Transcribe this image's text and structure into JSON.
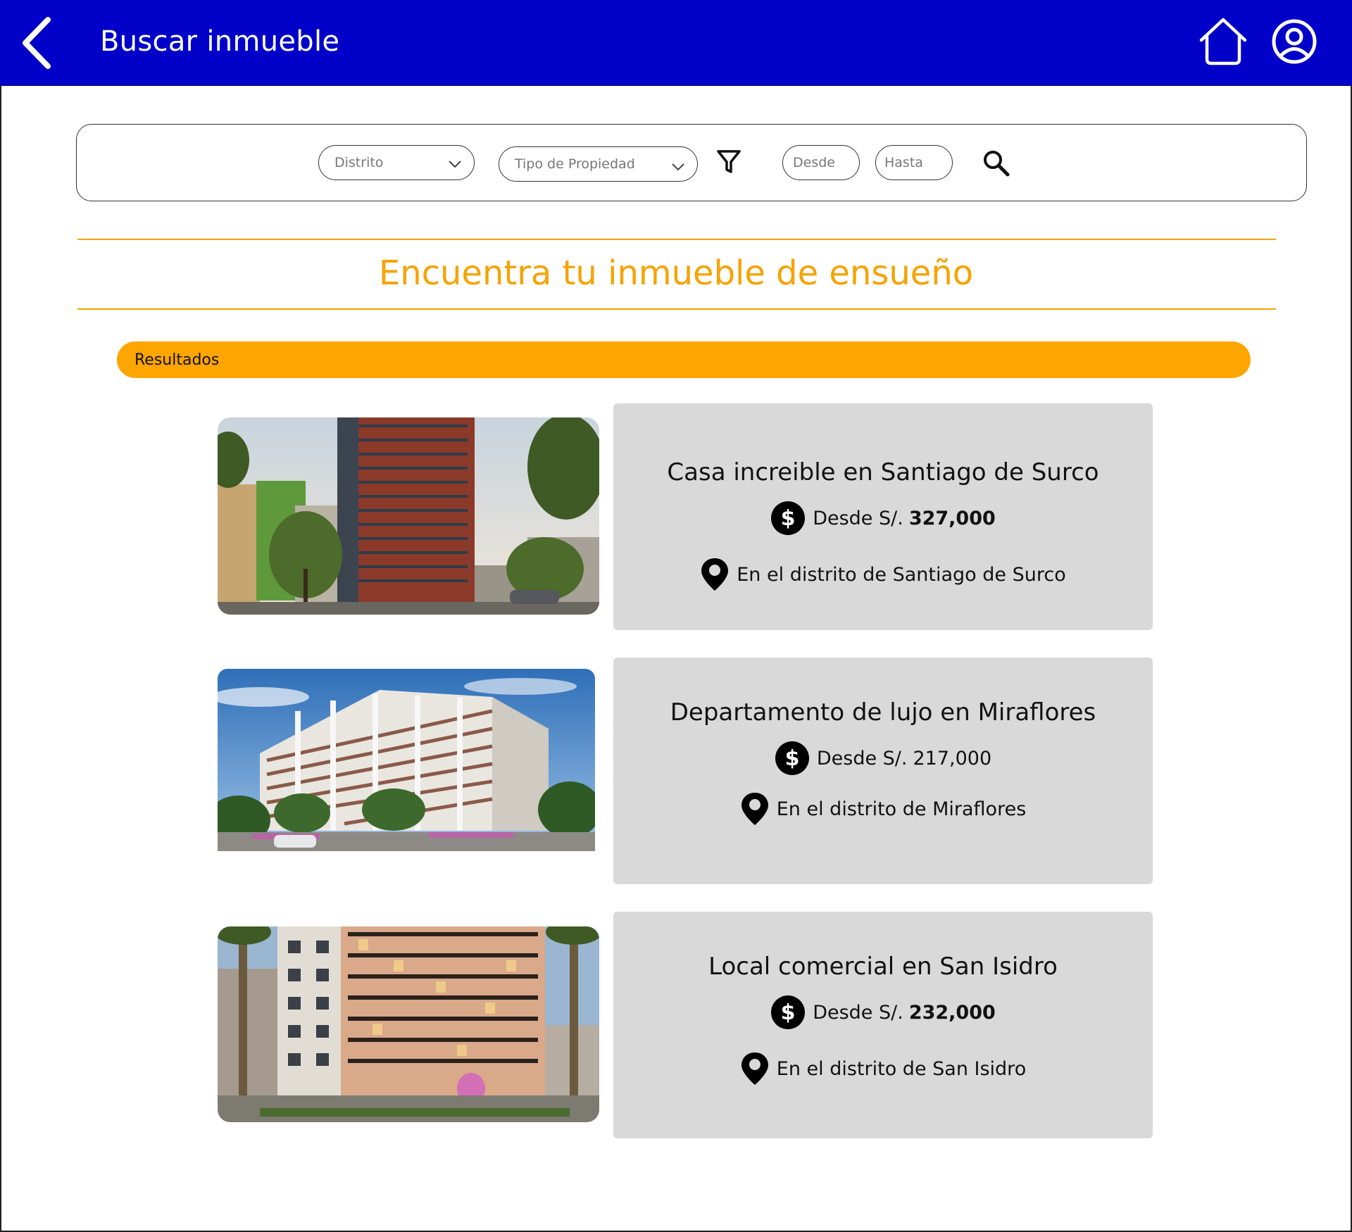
{
  "header": {
    "title": "Buscar inmueble",
    "back_icon": "chevron-left-icon",
    "home_icon": "home-icon",
    "profile_icon": "user-circle-icon",
    "background": "#0000c8"
  },
  "search": {
    "district_placeholder": "Distrito",
    "property_type_placeholder": "Tipo de Propiedad",
    "price_from_placeholder": "Desde",
    "price_to_placeholder": "Hasta",
    "filter_icon": "filter-icon",
    "search_icon": "search-icon"
  },
  "main": {
    "heading": "Encuentra tu inmueble de ensueño",
    "results_label": "Resultados",
    "accent_color": "#ffa500"
  },
  "listings": [
    {
      "title": "Casa increible en Santiago de Surco",
      "price_prefix": "Desde S/.",
      "price": "327,000",
      "location": "En el distrito de Santiago de Surco"
    },
    {
      "title": "Departamento de lujo en Miraflores",
      "price_prefix": "Desde S/.",
      "price": "217,000",
      "location": "En el distrito de Miraflores"
    },
    {
      "title": "Local comercial en San Isidro",
      "price_prefix": "Desde S/.",
      "price": "232,000",
      "location": "En el distrito de San Isidro"
    }
  ]
}
